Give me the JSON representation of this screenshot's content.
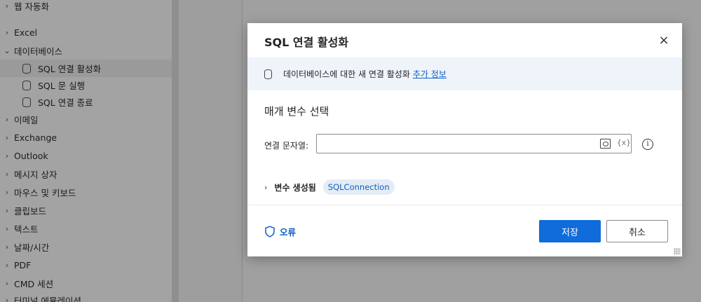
{
  "sidebar": {
    "items": [
      {
        "label": "웹 자동화",
        "chevron": "›"
      },
      {
        "label": "Excel",
        "chevron": "›"
      },
      {
        "label": "데이터베이스",
        "chevron": "⌄"
      },
      {
        "label": "SQL 연결 활성화",
        "icon": "database-icon",
        "selected": true
      },
      {
        "label": "SQL 문 실행",
        "icon": "database-icon"
      },
      {
        "label": "SQL 연결 종료",
        "icon": "database-icon"
      },
      {
        "label": "이메일",
        "chevron": "›"
      },
      {
        "label": "Exchange",
        "chevron": "›"
      },
      {
        "label": "Outlook",
        "chevron": "›"
      },
      {
        "label": "메시지 상자",
        "chevron": "›"
      },
      {
        "label": "마우스 및 키보드",
        "chevron": "›"
      },
      {
        "label": "클립보드",
        "chevron": "›"
      },
      {
        "label": "텍스트",
        "chevron": "›"
      },
      {
        "label": "날짜/시간",
        "chevron": "›"
      },
      {
        "label": "PDF",
        "chevron": "›"
      },
      {
        "label": "CMD 세션",
        "chevron": "›"
      },
      {
        "label": "터미널 에뮬레이션",
        "chevron": "›"
      }
    ]
  },
  "dialog": {
    "title": "SQL 연결 활성화",
    "close_icon": "×",
    "info_text": "데이터베이스에 대한 새 연결 활성화",
    "info_link": "추가 정보",
    "section_title": "매개 변수 선택",
    "connection_label": "연결 문자열:",
    "connection_value": "",
    "variable_icon_text": "{x}",
    "help_icon_text": "i",
    "vars_chevron": "›",
    "vars_label": "변수 생성됨",
    "vars_chip": "SQLConnection",
    "error_label": "오류",
    "save_label": "저장",
    "cancel_label": "취소"
  },
  "colors": {
    "accent": "#0f6cda",
    "link": "#0f5fc1",
    "info_bg": "#eff4fb",
    "chip_bg": "#e4ecf6"
  }
}
